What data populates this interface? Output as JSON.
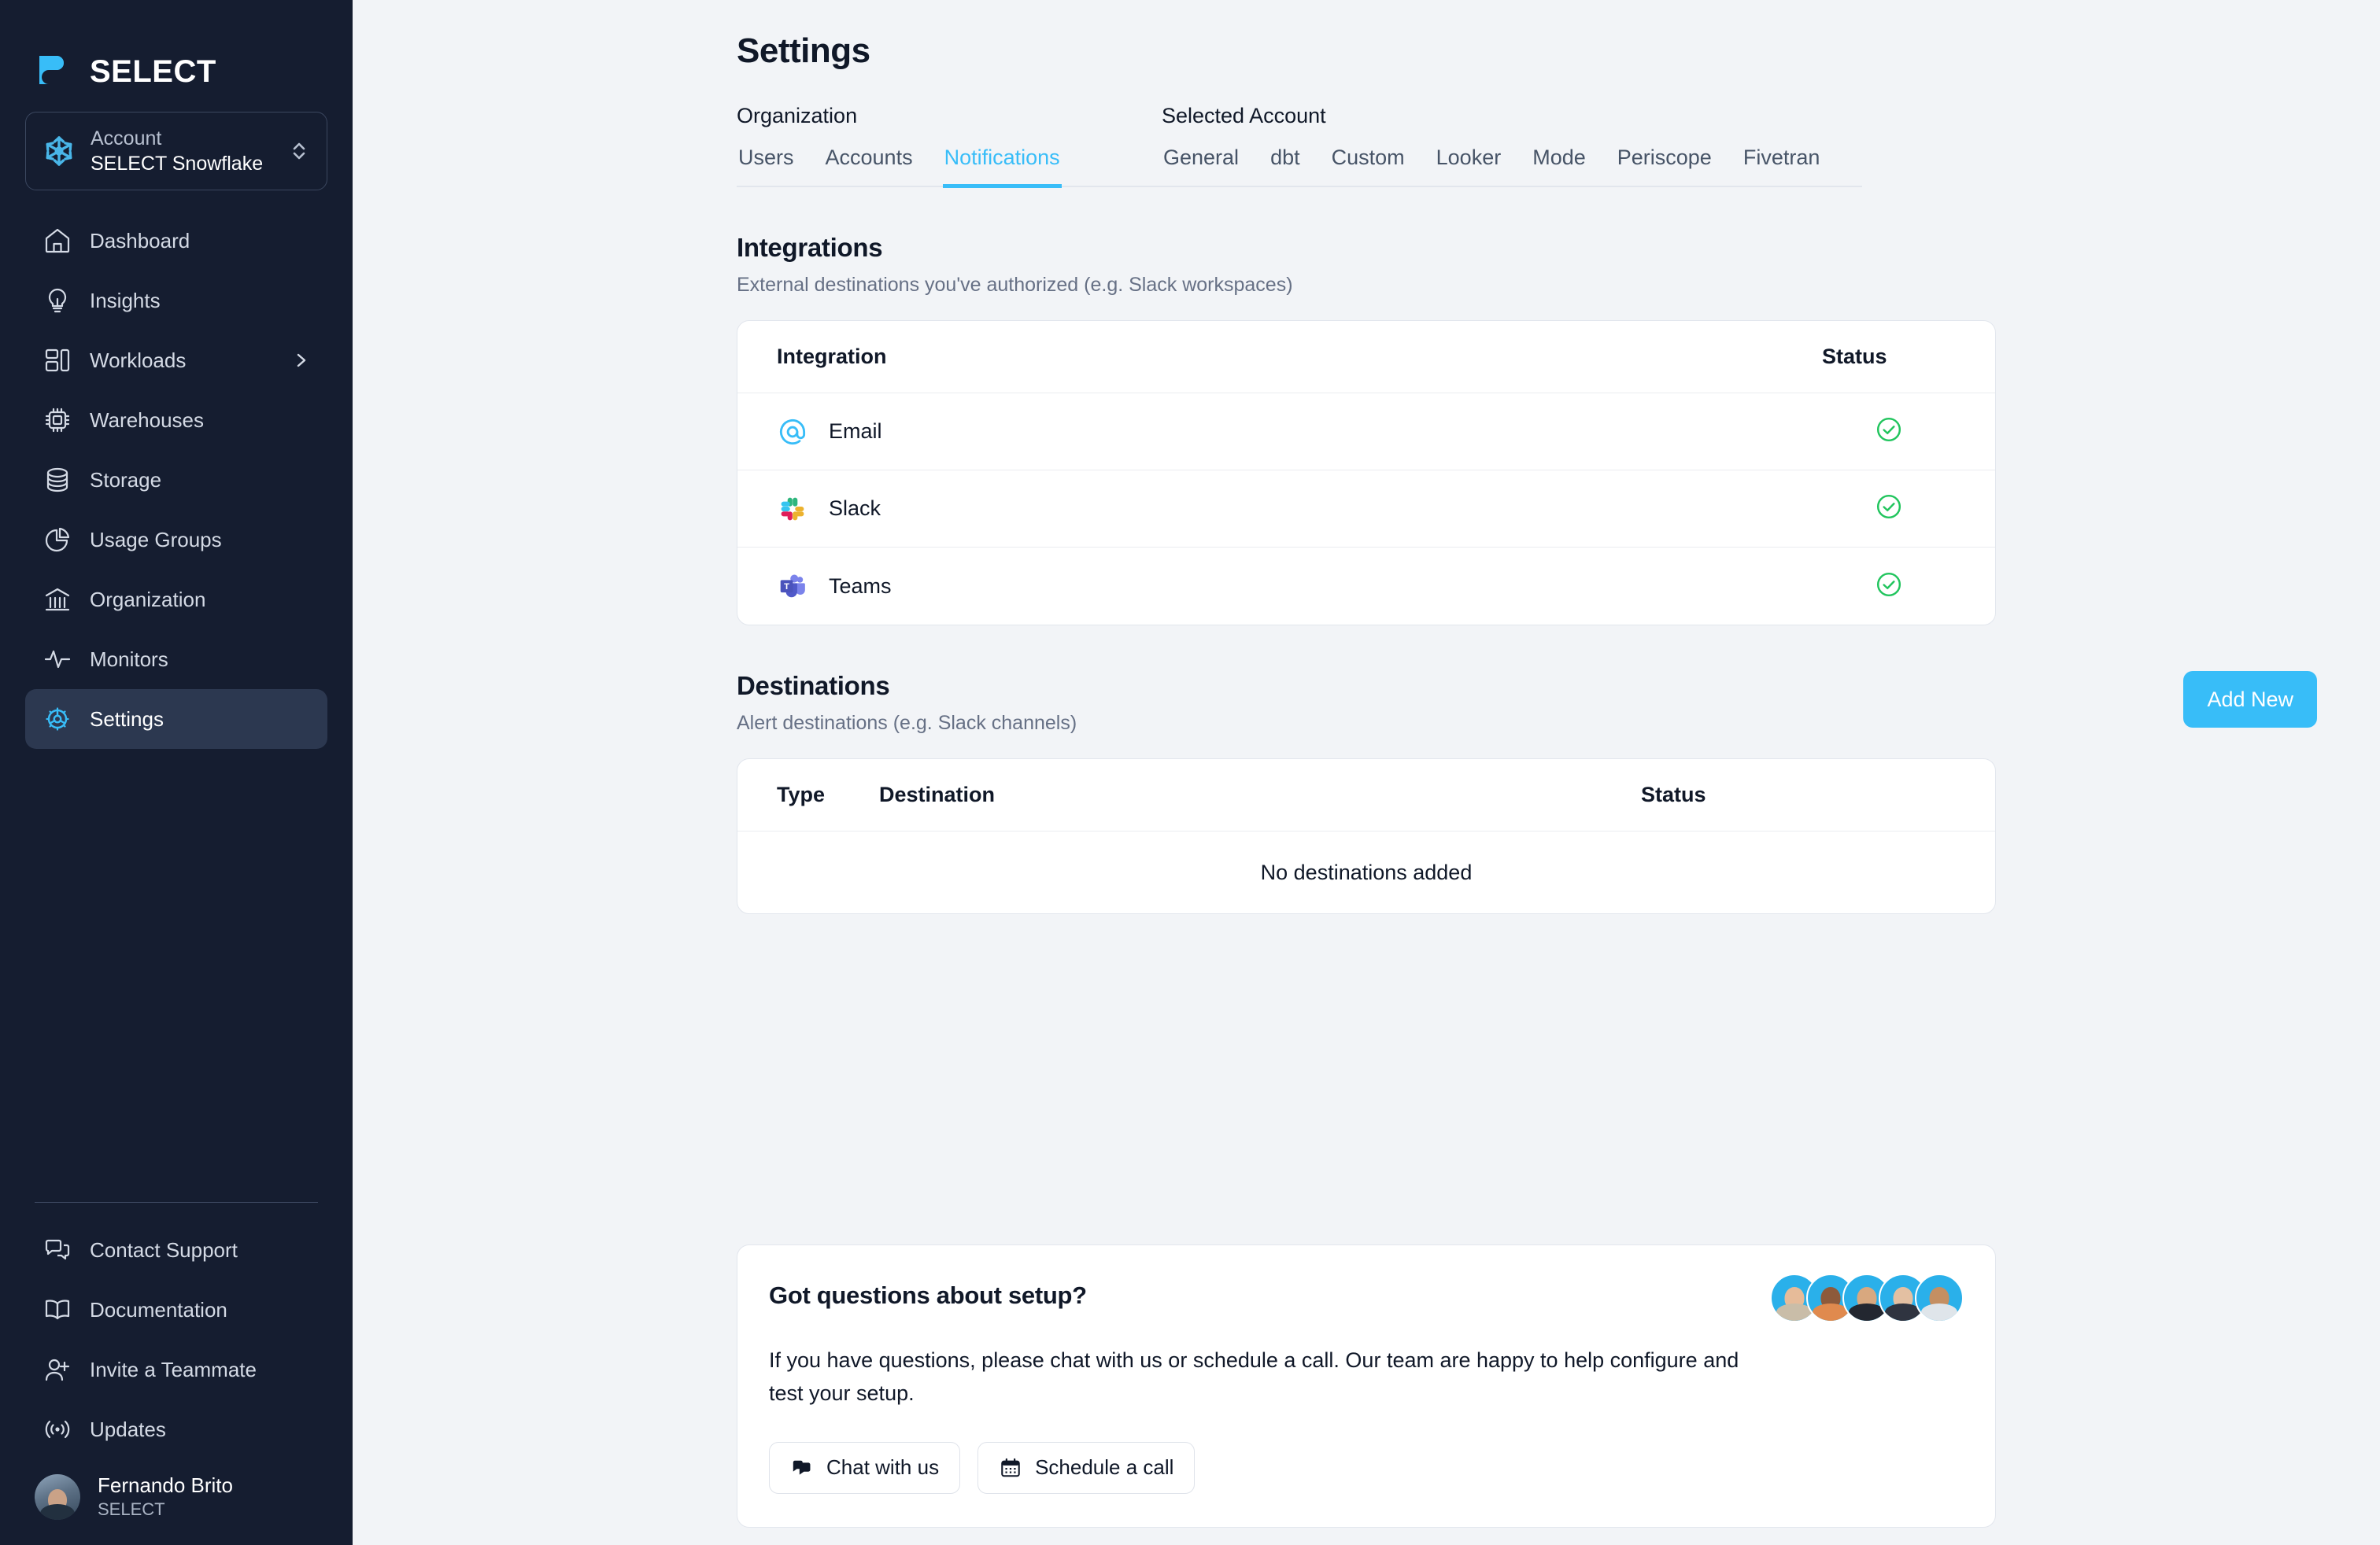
{
  "brand": {
    "name": "SELECT",
    "logo_icon": "select-logo-icon",
    "accent_color": "#38bdf8"
  },
  "sidebar": {
    "account_switcher": {
      "icon": "snowflake-icon",
      "label": "Account",
      "value": "SELECT Snowflake",
      "chevron_icon": "chevron-up-down-icon"
    },
    "items": [
      {
        "label": "Dashboard",
        "icon": "home-icon",
        "active": false,
        "expandable": false
      },
      {
        "label": "Insights",
        "icon": "lightbulb-icon",
        "active": false,
        "expandable": false
      },
      {
        "label": "Workloads",
        "icon": "layout-blocks-icon",
        "active": false,
        "expandable": true
      },
      {
        "label": "Warehouses",
        "icon": "cpu-chip-icon",
        "active": false,
        "expandable": false
      },
      {
        "label": "Storage",
        "icon": "database-icon",
        "active": false,
        "expandable": false
      },
      {
        "label": "Usage Groups",
        "icon": "pie-chart-icon",
        "active": false,
        "expandable": false
      },
      {
        "label": "Organization",
        "icon": "bank-icon",
        "active": false,
        "expandable": false
      },
      {
        "label": "Monitors",
        "icon": "activity-pulse-icon",
        "active": false,
        "expandable": false
      },
      {
        "label": "Settings",
        "icon": "gear-icon",
        "active": true,
        "expandable": false
      }
    ],
    "bottom_items": [
      {
        "label": "Contact Support",
        "icon": "chat-bubbles-icon"
      },
      {
        "label": "Documentation",
        "icon": "open-book-icon"
      },
      {
        "label": "Invite a Teammate",
        "icon": "user-plus-icon"
      },
      {
        "label": "Updates",
        "icon": "broadcast-icon"
      }
    ],
    "user": {
      "name": "Fernando Brito",
      "org": "SELECT",
      "avatar": "user-avatar"
    }
  },
  "header": {
    "title": "Settings"
  },
  "tab_groups": [
    {
      "label": "Organization",
      "tabs": [
        {
          "label": "Users",
          "active": false
        },
        {
          "label": "Accounts",
          "active": false
        },
        {
          "label": "Notifications",
          "active": true
        }
      ]
    },
    {
      "label": "Selected Account",
      "tabs": [
        {
          "label": "General",
          "active": false
        },
        {
          "label": "dbt",
          "active": false
        },
        {
          "label": "Custom",
          "active": false
        },
        {
          "label": "Looker",
          "active": false
        },
        {
          "label": "Mode",
          "active": false
        },
        {
          "label": "Periscope",
          "active": false
        },
        {
          "label": "Fivetran",
          "active": false
        }
      ]
    }
  ],
  "integrations_section": {
    "title": "Integrations",
    "subtitle": "External destinations you've authorized (e.g. Slack workspaces)",
    "columns": {
      "integration": "Integration",
      "status": "Status"
    },
    "rows": [
      {
        "name": "Email",
        "icon": "email-at-icon",
        "status": "authorized",
        "status_icon": "check-circle-icon"
      },
      {
        "name": "Slack",
        "icon": "slack-icon",
        "status": "authorized",
        "status_icon": "check-circle-icon"
      },
      {
        "name": "Teams",
        "icon": "microsoft-teams-icon",
        "status": "authorized",
        "status_icon": "check-circle-icon"
      }
    ]
  },
  "destinations_section": {
    "title": "Destinations",
    "subtitle": "Alert destinations (e.g. Slack channels)",
    "add_button": "Add New",
    "columns": {
      "type": "Type",
      "destination": "Destination",
      "status": "Status"
    },
    "empty_message": "No destinations added",
    "rows": []
  },
  "help_card": {
    "title": "Got questions about setup?",
    "body": "If you have questions, please chat with us or schedule a call. Our team are happy to help configure and test your setup.",
    "chat_button": {
      "label": "Chat with us",
      "icon": "chat-bubbles-icon"
    },
    "call_button": {
      "label": "Schedule a call",
      "icon": "calendar-icon"
    },
    "avatar_count": 5
  },
  "colors": {
    "sidebar_bg": "#151d30",
    "page_bg": "#f2f4f7",
    "accent": "#38bdf8",
    "success": "#22c55e",
    "card_border": "#e2e6ed"
  }
}
